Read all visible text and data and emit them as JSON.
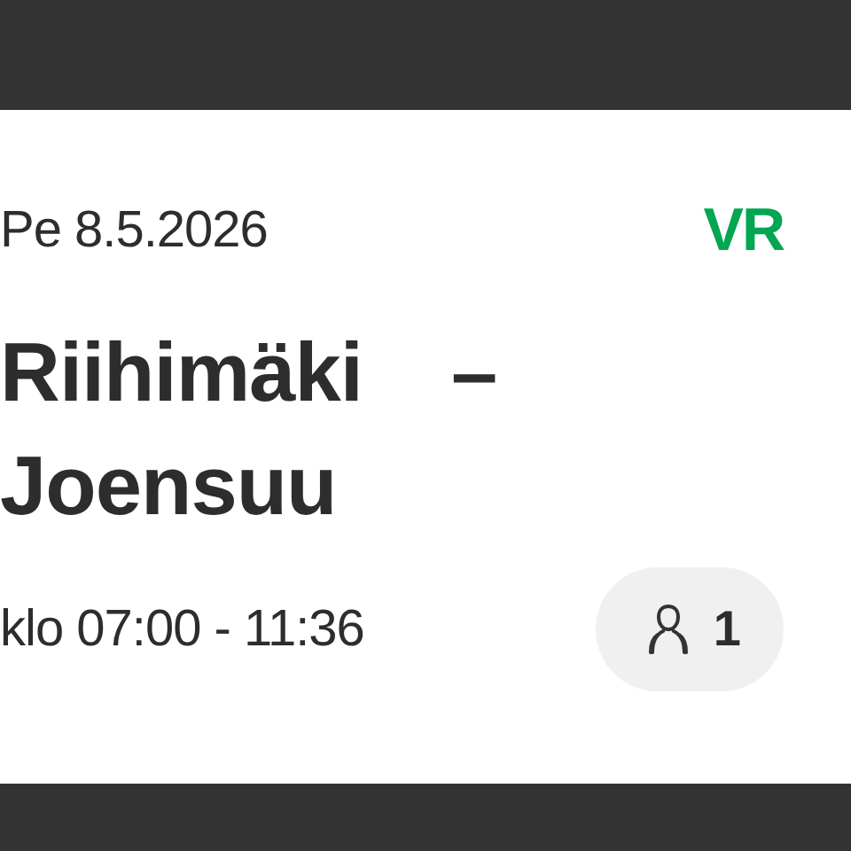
{
  "date": "Pe 8.5.2026",
  "logo": "VR",
  "route": {
    "origin": "Riihimäki",
    "separator": "–",
    "destination": "Joensuu"
  },
  "time": "klo 07:00 - 11:36",
  "passengers": "1"
}
